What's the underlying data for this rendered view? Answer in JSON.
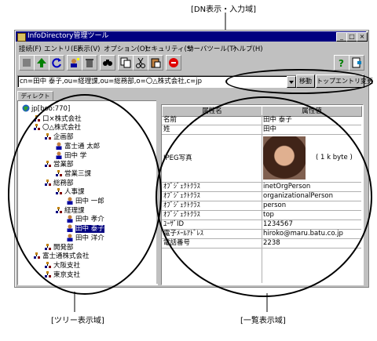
{
  "annotations": {
    "dn_area": "[DN表示・入力域]",
    "tree_area": "[ツリー表示域]",
    "list_area": "[一覧表示域]"
  },
  "window": {
    "title": "InfoDirectory管理ツール"
  },
  "menu": [
    "接続(F)",
    "エントリ(E)",
    "表示(V)",
    "オプション(O)",
    "セキュリティ(S)",
    "サーバツール(T)",
    "ヘルプ(H)"
  ],
  "dn": {
    "value": "cn=田中 泰子,ou=経理課,ou=総務部,o=〇△株式会社,c=jp",
    "move_button": "移動",
    "top_entry_button": "トップエントリ変更"
  },
  "tab": {
    "label": "ディレクトリ"
  },
  "tree": [
    {
      "label": "jp[boo:770]",
      "level": 0,
      "type": "globe"
    },
    {
      "label": "口×株式会社",
      "level": 1,
      "type": "org"
    },
    {
      "label": "〇△株式会社",
      "level": 1,
      "type": "org"
    },
    {
      "label": "企画部",
      "level": 2,
      "type": "org"
    },
    {
      "label": "富士通 太郎",
      "level": 3,
      "type": "person"
    },
    {
      "label": "田中 学",
      "level": 3,
      "type": "person"
    },
    {
      "label": "営業部",
      "level": 2,
      "type": "org"
    },
    {
      "label": "営業三課",
      "level": 3,
      "type": "org"
    },
    {
      "label": "総務部",
      "level": 2,
      "type": "org"
    },
    {
      "label": "人事課",
      "level": 3,
      "type": "org"
    },
    {
      "label": "田中 一郎",
      "level": 4,
      "type": "person"
    },
    {
      "label": "経理課",
      "level": 3,
      "type": "org"
    },
    {
      "label": "田中 孝介",
      "level": 4,
      "type": "person"
    },
    {
      "label": "田中 泰子",
      "level": 4,
      "type": "person",
      "selected": true
    },
    {
      "label": "田中 洋介",
      "level": 4,
      "type": "person"
    },
    {
      "label": "開発部",
      "level": 2,
      "type": "org"
    },
    {
      "label": "富士通株式会社",
      "level": 1,
      "type": "org"
    },
    {
      "label": "大阪支社",
      "level": 2,
      "type": "org"
    },
    {
      "label": "東京支社",
      "level": 2,
      "type": "org"
    }
  ],
  "list": {
    "col_name": "属性名",
    "col_value": "属性値",
    "photo_size": "( 1 k byte )",
    "rows": [
      {
        "name": "名前",
        "value": "田中 泰子"
      },
      {
        "name": "姓",
        "value": "田中"
      },
      {
        "name": "JPEG写真",
        "value": ""
      },
      {
        "name": "ｵﾌﾞｼﾞｪｸﾄｸﾗｽ",
        "value": "inetOrgPerson"
      },
      {
        "name": "ｵﾌﾞｼﾞｪｸﾄｸﾗｽ",
        "value": "organizationalPerson"
      },
      {
        "name": "ｵﾌﾞｼﾞｪｸﾄｸﾗｽ",
        "value": "person"
      },
      {
        "name": "ｵﾌﾞｼﾞｪｸﾄｸﾗｽ",
        "value": "top"
      },
      {
        "name": "ﾕｰｻﾞID",
        "value": "1234567"
      },
      {
        "name": "電子ﾒｰﾙｱﾄﾞﾚｽ",
        "value": "hiroko@maru.batu.co.jp"
      },
      {
        "name": "電話番号",
        "value": "2238"
      }
    ]
  }
}
